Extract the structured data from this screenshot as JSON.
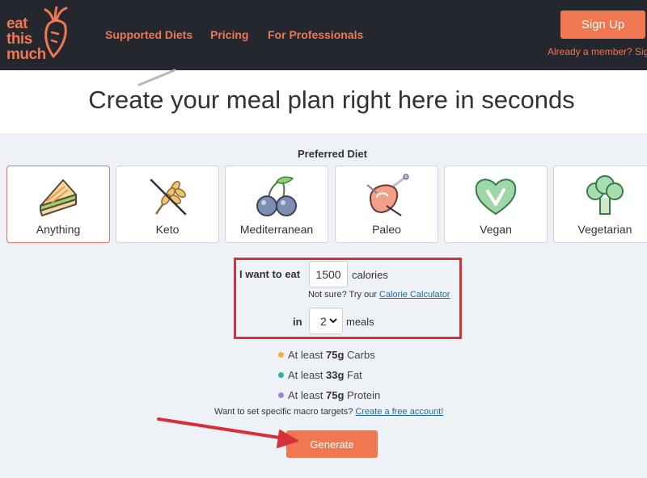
{
  "header": {
    "logo": {
      "line1": "eat",
      "line2": "this",
      "line3": "much"
    },
    "nav": [
      "Supported Diets",
      "Pricing",
      "For Professionals"
    ],
    "signup_label": "Sign Up",
    "member_text": "Already a member? Sign"
  },
  "hero": {
    "title": "Create your meal plan right here in seconds"
  },
  "diet": {
    "label": "Preferred Diet",
    "options": [
      {
        "label": "Anything",
        "icon": "sandwich-icon"
      },
      {
        "label": "Keto",
        "icon": "no-wheat-icon"
      },
      {
        "label": "Mediterranean",
        "icon": "olives-icon"
      },
      {
        "label": "Paleo",
        "icon": "meat-icon"
      },
      {
        "label": "Vegan",
        "icon": "heart-check-icon"
      },
      {
        "label": "Vegetarian",
        "icon": "broccoli-icon"
      }
    ],
    "selected": "Anything"
  },
  "form": {
    "want_label": "I want to eat",
    "calories_value": "1500",
    "calories_unit": "calories",
    "not_sure": "Not sure? Try our",
    "calc_link": "Calorie Calculator",
    "in_label": "in",
    "meals_value": "2",
    "meals_unit": "meals"
  },
  "macros": [
    {
      "prefix": "At least",
      "amount": "75g",
      "name": "Carbs",
      "color": "#f2b33d"
    },
    {
      "prefix": "At least",
      "amount": "33g",
      "name": "Fat",
      "color": "#2bb5a8"
    },
    {
      "prefix": "At least",
      "amount": "75g",
      "name": "Protein",
      "color": "#a283d6"
    }
  ],
  "specific_text": "Want to set specific macro targets?",
  "specific_link": "Create a free account!",
  "generate_label": "Generate",
  "colors": {
    "accent": "#f0774f",
    "header_bg": "#24272e",
    "annotation": "#d6313a"
  }
}
